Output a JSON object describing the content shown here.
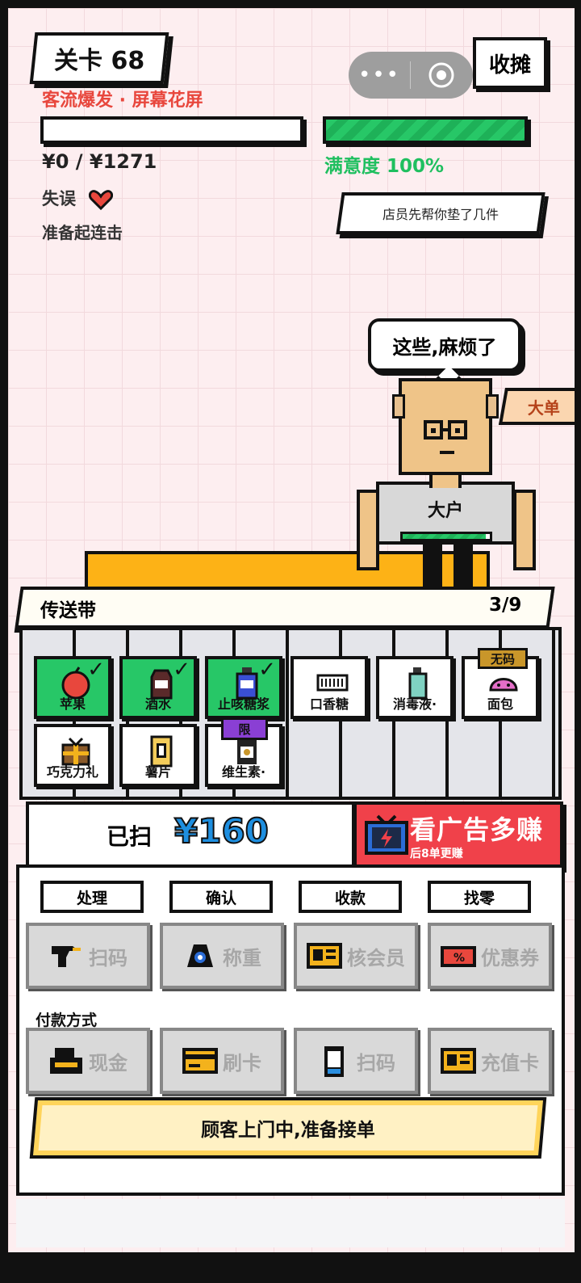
{
  "hud": {
    "level": "关卡 68",
    "event": "客流爆发 · 屏幕花屏",
    "money": "¥0 / ¥1271",
    "money_progress": 0.0,
    "satisfaction": "满意度 100%",
    "satisfaction_progress": 1.0,
    "mistakes_label": "失误",
    "combo_label": "准备起连击"
  },
  "system": {
    "menu_dots": "•••",
    "close_stall": "收摊"
  },
  "tip": "店员先帮你垫了几件",
  "customer": {
    "speech": "这些,麻烦了",
    "badge": "大单",
    "type_label": "大户",
    "patience": 0.95
  },
  "belt": {
    "title": "传送带",
    "count": "3/9",
    "items": [
      {
        "name": "苹果",
        "scanned": true,
        "icon": "apple-icon"
      },
      {
        "name": "酒水",
        "scanned": true,
        "icon": "bottle-icon"
      },
      {
        "name": "止咳糖浆",
        "scanned": true,
        "icon": "syrup-icon"
      },
      {
        "name": "口香糖",
        "scanned": false,
        "icon": "gum-icon"
      },
      {
        "name": "消毒液·",
        "scanned": false,
        "icon": "disinfectant-icon"
      },
      {
        "name": "面包",
        "scanned": false,
        "icon": "bread-icon",
        "tag": "无码"
      },
      {
        "name": "巧克力礼",
        "scanned": false,
        "icon": "gift-icon"
      },
      {
        "name": "薯片",
        "scanned": false,
        "icon": "chips-icon"
      },
      {
        "name": "维生素·",
        "scanned": false,
        "icon": "vitamin-icon",
        "tag": "限"
      }
    ]
  },
  "scanned": {
    "label": "已扫",
    "value": "¥160"
  },
  "ad": {
    "title": "看广告多赚",
    "subtitle": "后8单更赚"
  },
  "steps": [
    "处理",
    "确认",
    "收款",
    "找零"
  ],
  "actions": [
    {
      "label": "扫码",
      "icon": "scanner-icon"
    },
    {
      "label": "称重",
      "icon": "scale-icon"
    },
    {
      "label": "核会员",
      "icon": "member-card-icon"
    },
    {
      "label": "优惠券",
      "icon": "coupon-icon"
    }
  ],
  "payment_title": "付款方式",
  "payments": [
    {
      "label": "现金",
      "icon": "cash-register-icon"
    },
    {
      "label": "刷卡",
      "icon": "bank-card-icon"
    },
    {
      "label": "扫码",
      "icon": "phone-qr-icon"
    },
    {
      "label": "充值卡",
      "icon": "prepaid-card-icon"
    }
  ],
  "status": "顾客上门中,准备接单",
  "colors": {
    "green": "#27c767",
    "red": "#e8473d",
    "blue": "#1e8fe0",
    "yellow": "#fdb216",
    "ad": "#f0414a"
  }
}
